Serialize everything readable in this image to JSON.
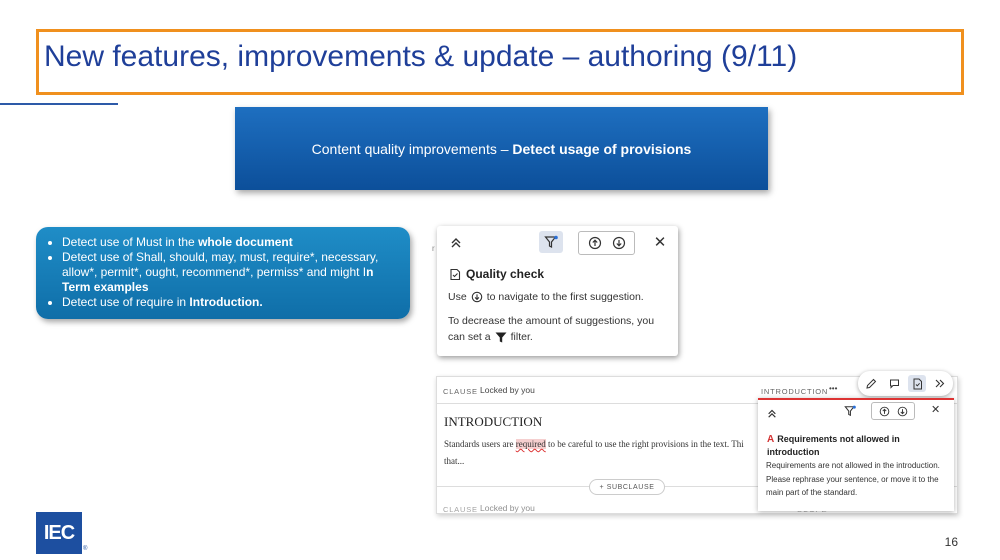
{
  "slide": {
    "title": "New features, improvements & update – authoring (9/11)",
    "banner_prefix": "Content quality improvements – ",
    "banner_bold": "Detect usage of provisions",
    "page_number": "16",
    "logo_text": "IEC",
    "logo_mark": "®"
  },
  "bullets": [
    {
      "text": "Detect use of Must in the ",
      "bold": "whole document",
      "tail": ""
    },
    {
      "text": "Detect use of Shall, should, may, must, require*, necessary, allow*, permit*, ought, recommend*, permiss* and might I",
      "bold": "n Term examples",
      "tail": ""
    },
    {
      "text": "Detect use of require in ",
      "bold": "Introduction.",
      "tail": ""
    }
  ],
  "quality_check": {
    "title": "Quality check",
    "line1_pre": "Use",
    "line1_post": "to navigate to the first suggestion.",
    "line2": "To decrease the amount of suggestions, you",
    "line3_pre": "can set a",
    "line3_post": "filter.",
    "margin_mark": "r"
  },
  "editor": {
    "clause_label": "CLAUSE",
    "locked": "Locked by you",
    "section_label": "INTRODUCTION",
    "more": "•••",
    "heading": "INTRODUCTION",
    "para_pre": "Standards users are ",
    "para_req": "required",
    "para_post": " to be careful to use the right provisions in the text. Thi",
    "para_cont": "that...",
    "subclause": "+ SUBCLAUSE",
    "footer_label": "CLAUSE",
    "footer_locked": "Locked by you",
    "footer_right": "SCOPE"
  },
  "suggestion": {
    "title": "Requirements not allowed in introduction",
    "body": "Requirements are not allowed in the introduction. Please rephrase your sentence, or move it to the main part of the standard."
  },
  "colors": {
    "title_border": "#f0901e",
    "title_text": "#1f3f99",
    "banner": "#1466b4",
    "bullets_box": "#1a82bd",
    "warning": "#d33333"
  }
}
